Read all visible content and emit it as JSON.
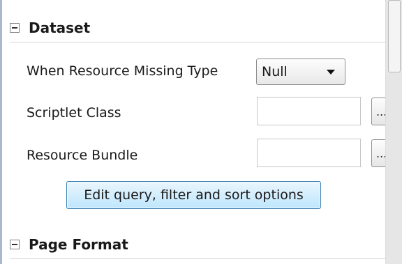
{
  "dataset": {
    "title": "Dataset",
    "resource_missing": {
      "label": "When Resource Missing Type",
      "value": "Null"
    },
    "scriptlet_class": {
      "label": "Scriptlet Class",
      "value": "",
      "browse_label": "..."
    },
    "resource_bundle": {
      "label": "Resource Bundle",
      "value": "",
      "browse_label": "..."
    },
    "edit_query_button": "Edit query, filter and sort options"
  },
  "page_format": {
    "title": "Page Format"
  }
}
